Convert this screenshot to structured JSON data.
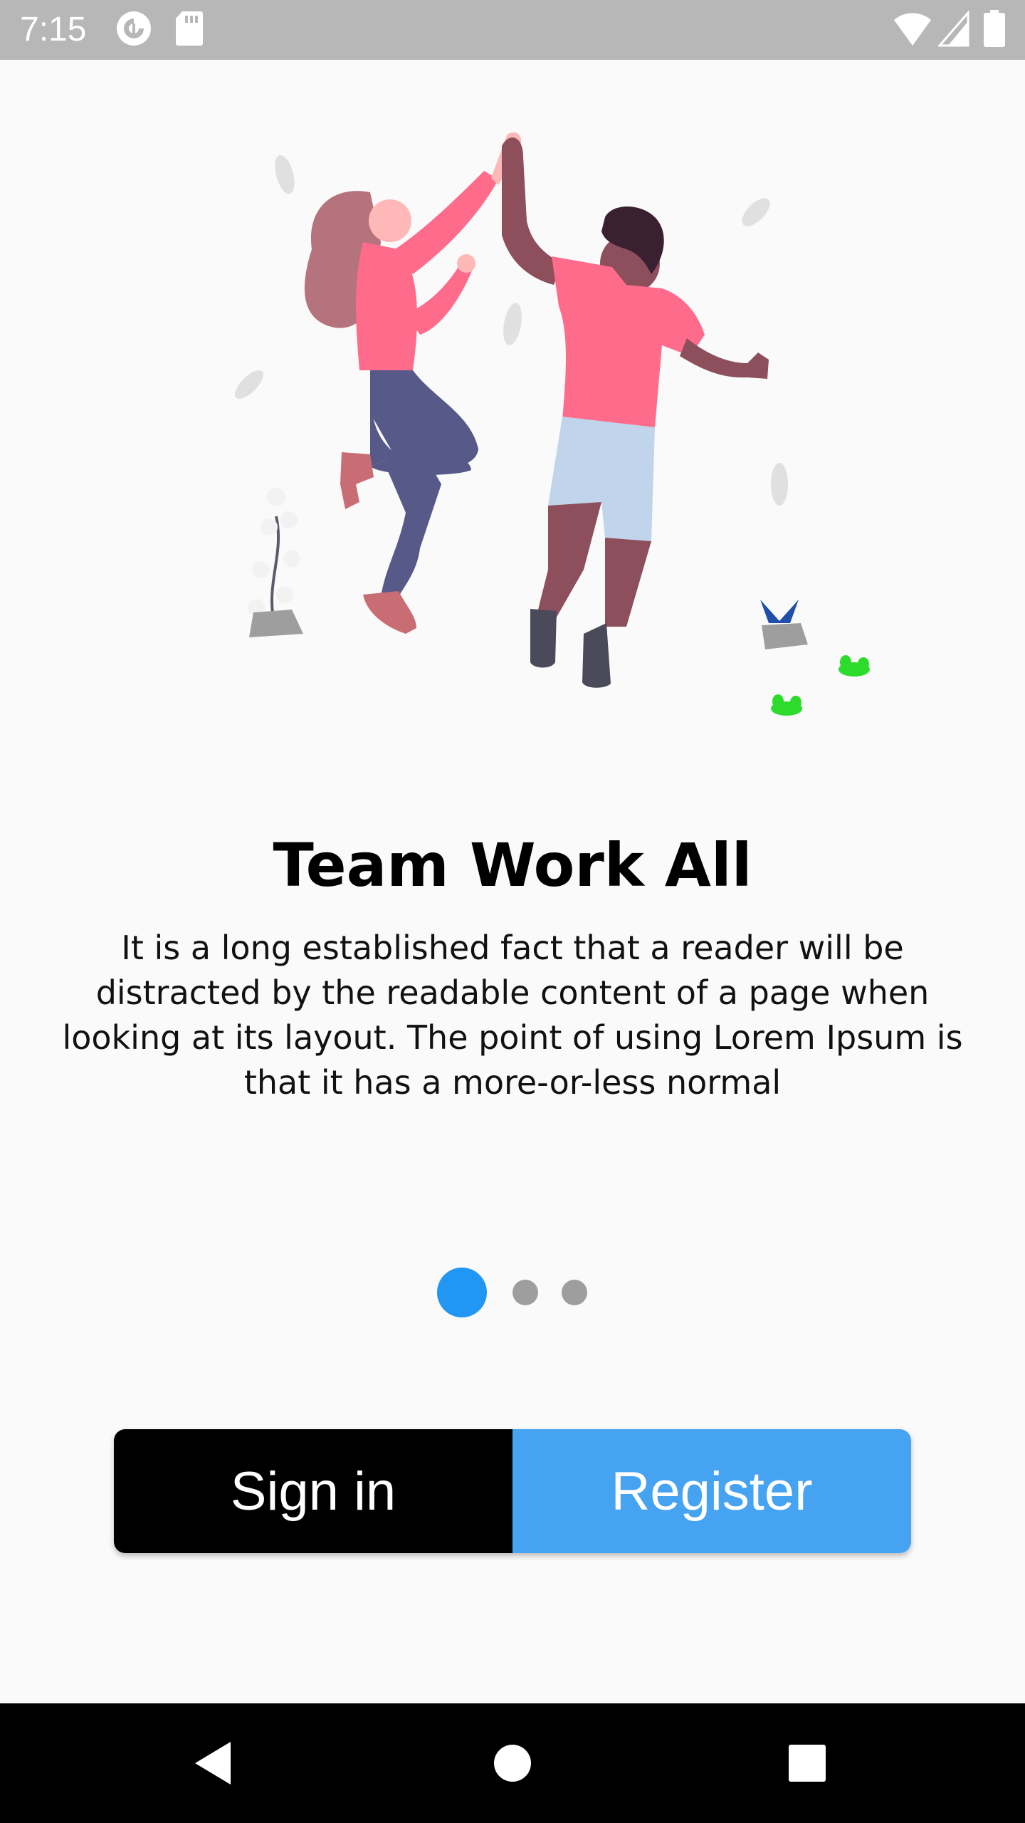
{
  "status_bar": {
    "time": "7:15",
    "icons": [
      "pocket-casts-icon",
      "sd-card-icon",
      "wifi-icon",
      "signal-icon",
      "battery-icon"
    ]
  },
  "illustration": {
    "name": "two-people-high-five-illustration",
    "colors": {
      "shirt_pink": "#fe6b8b",
      "skin_light": "#ffb8b8",
      "skin_dark": "#8c4f5b",
      "hair_woman": "#b5737d",
      "hair_man": "#3a2031",
      "pants": "#575a89",
      "shorts": "#c0d4ec",
      "leaf": "#e0e0e0",
      "plant_green": "#2ddb2d",
      "pot_grey": "#9e9e9e"
    }
  },
  "onboarding": {
    "title": "Team Work All",
    "body": "It is a long established fact that a reader will be distracted by the readable content of a page when looking at its layout. The point of using Lorem Ipsum is that it has a more-or-less normal",
    "page_indicator": {
      "current_page": 1,
      "total_pages": 3,
      "active_color": "#2196f3",
      "inactive_color": "#9e9e9e"
    }
  },
  "actions": {
    "signin_label": "Sign in",
    "register_label": "Register",
    "signin_color": "#000000",
    "register_color": "#45a3f2"
  },
  "nav_bar": {
    "icons": [
      "back-icon",
      "home-icon",
      "recents-icon"
    ]
  }
}
